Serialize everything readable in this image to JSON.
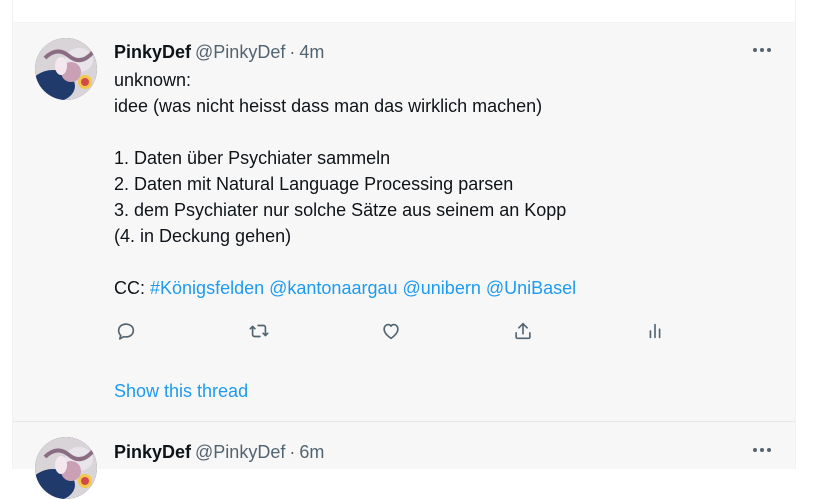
{
  "tweets": [
    {
      "name": "PinkyDef",
      "handle": "@PinkyDef",
      "separator": "·",
      "time": "4m",
      "avatar_icon": "profile-avatar",
      "lines": [
        "unknown:",
        "idee (was nicht heisst dass man das wirklich machen)",
        "",
        "1. Daten über Psychiater sammeln",
        "2. Daten mit Natural Language Processing parsen",
        "3. dem Psychiater nur solche Sätze aus seinem an Kopp",
        "(4. in Deckung gehen)"
      ],
      "cc_prefix": "CC:",
      "mentions": [
        "#Königsfelden",
        "@kantonaargau",
        "@unibern",
        "@UniBasel"
      ],
      "actions": [
        "reply-icon",
        "retweet-icon",
        "like-icon",
        "share-icon",
        "analytics-icon"
      ],
      "show_thread": "Show this thread"
    },
    {
      "name": "PinkyDef",
      "handle": "@PinkyDef",
      "separator": "·",
      "time": "6m",
      "avatar_icon": "profile-avatar"
    }
  ],
  "colors": {
    "link": "#1d9bf0",
    "secondary_text": "#536471",
    "primary_text": "#0f1419",
    "tweet_background": "#f7f7f7"
  }
}
